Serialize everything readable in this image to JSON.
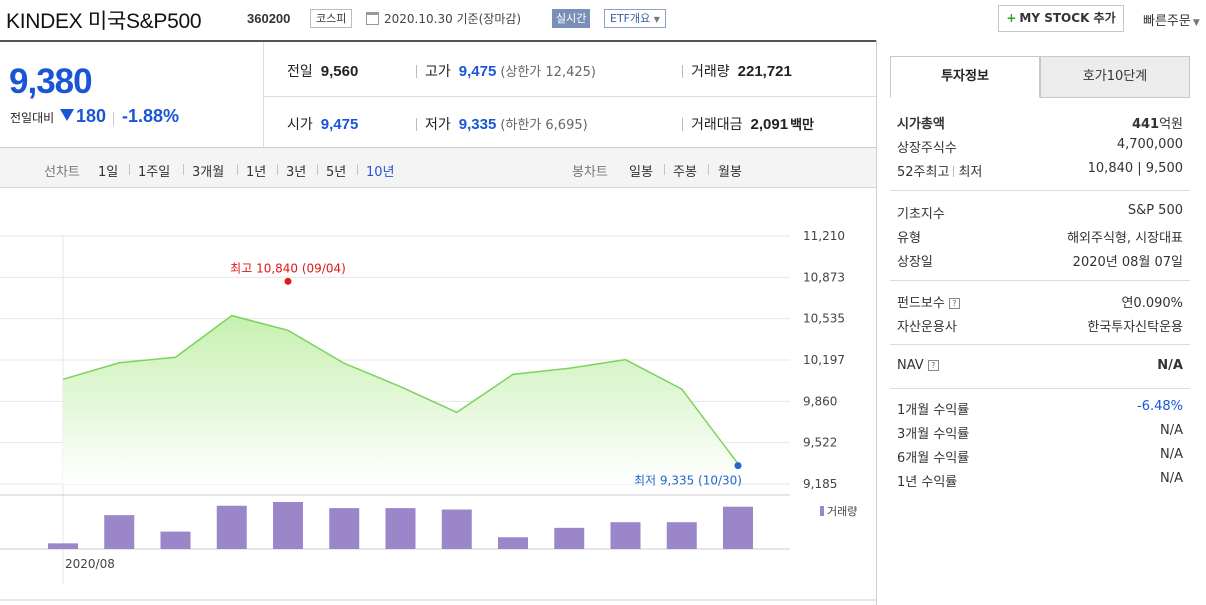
{
  "header": {
    "title": "KINDEX 미국S&P500",
    "code": "360200",
    "market": "코스피",
    "date_note": "2020.10.30 기준(장마감)",
    "realtime_label": "실시간",
    "etf_label": "ETF개요",
    "mystock_label": "MY STOCK 추가",
    "quick_order_label": "빠른주문"
  },
  "quote": {
    "price": "9,380",
    "compare_label": "전일대비",
    "change": "180",
    "change_pct": "-1.88%",
    "prev_close": {
      "label": "전일",
      "value": "9,560"
    },
    "open": {
      "label": "시가",
      "value": "9,475"
    },
    "high": {
      "label": "고가",
      "value": "9,475",
      "sub": "(상한가 12,425)"
    },
    "low": {
      "label": "저가",
      "value": "9,335",
      "sub": "(하한가 6,695)"
    },
    "volume": {
      "label": "거래량",
      "value": "221,721"
    },
    "amount": {
      "label": "거래대금",
      "value": "2,091",
      "unit": "백만"
    }
  },
  "periods": {
    "line_label": "선차트",
    "line_items": [
      "1일",
      "1주일",
      "3개월",
      "1년",
      "3년",
      "5년",
      "10년"
    ],
    "active_line": "10년",
    "candle_label": "봉차트",
    "candle_items": [
      "일봉",
      "주봉",
      "월봉"
    ]
  },
  "chart_data": {
    "type": "area",
    "x": [
      "2020-08-07",
      "2020-08-14",
      "2020-08-21",
      "2020-08-28",
      "2020-09-04",
      "2020-09-11",
      "2020-09-18",
      "2020-09-25",
      "2020-10-02",
      "2020-10-09",
      "2020-10-16",
      "2020-10-23",
      "2020-10-30"
    ],
    "series": [
      {
        "values": [
          10040,
          10175,
          10220,
          10560,
          10440,
          10170,
          9980,
          9770,
          10080,
          10130,
          10200,
          9960,
          9350
        ]
      }
    ],
    "volume_legend": "거래량",
    "volume_values": [
      0.12,
      0.72,
      0.37,
      0.92,
      1.0,
      0.87,
      0.87,
      0.84,
      0.25,
      0.45,
      0.57,
      0.57,
      0.9
    ],
    "ylim": [
      9185,
      11210
    ],
    "yticks": [
      "11,210",
      "10,873",
      "10,535",
      "10,197",
      "9,860",
      "9,522",
      "9,185"
    ],
    "x_label": "2020/08",
    "high_annotation": "최고 10,840 (09/04)",
    "low_annotation": "최저 9,335 (10/30)",
    "high_value": 10840,
    "low_value": 9335,
    "colors": {
      "line": "#7cd35c",
      "fill_top": "#c7f0b1",
      "volume": "#9a86c8",
      "high": "#e01818",
      "low": "#2466cc"
    }
  },
  "info": {
    "tab_active": "투자정보",
    "tab_other": "호가10단계",
    "market_cap": {
      "label": "시가총액",
      "value": "441",
      "unit": "억원"
    },
    "shares": {
      "label": "상장주식수",
      "value": "4,700,000"
    },
    "week52": {
      "label": "52주최고",
      "label2": "최저",
      "value": "10,840 | 9,500"
    },
    "index": {
      "label": "기초지수",
      "value": "S&P 500"
    },
    "type": {
      "label": "유형",
      "value": "해외주식형, 시장대표"
    },
    "listing": {
      "label": "상장일",
      "value": "2020년 08월 07일"
    },
    "fee": {
      "label": "펀드보수",
      "value": "연0.090%"
    },
    "manager": {
      "label": "자산운용사",
      "value": "한국투자신탁운용"
    },
    "nav": {
      "label": "NAV",
      "value": "N/A"
    },
    "returns": [
      {
        "label": "1개월 수익률",
        "value": "-6.48%"
      },
      {
        "label": "3개월 수익률",
        "value": "N/A"
      },
      {
        "label": "6개월 수익률",
        "value": "N/A"
      },
      {
        "label": "1년 수익률",
        "value": "N/A"
      }
    ]
  }
}
